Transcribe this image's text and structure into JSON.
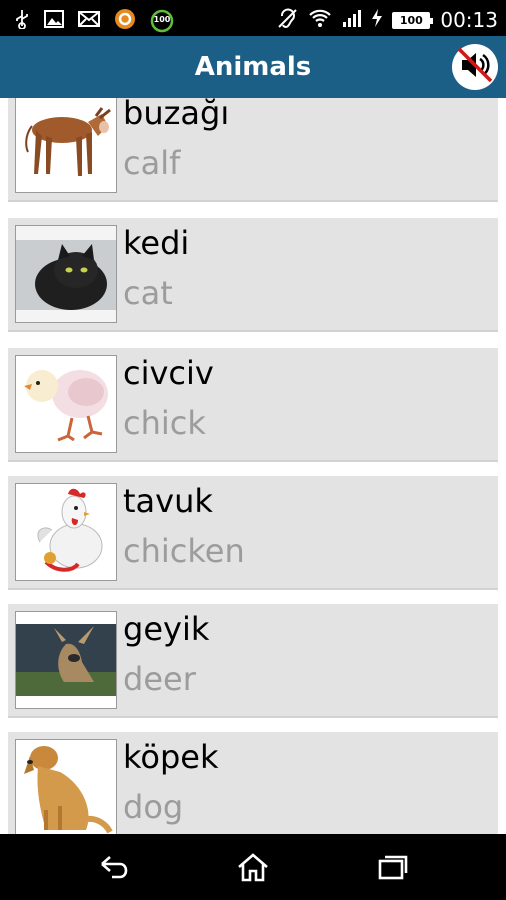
{
  "status_bar": {
    "battery_level": "100",
    "clock": "00:13",
    "notification_badge": "100"
  },
  "app_bar": {
    "title": "Animals",
    "mute_icon": "speaker-muted-icon"
  },
  "items": [
    {
      "word": "buzağı",
      "translation": "calf",
      "image": "calf-image"
    },
    {
      "word": "kedi",
      "translation": "cat",
      "image": "cat-image"
    },
    {
      "word": "civciv",
      "translation": "chick",
      "image": "chick-image"
    },
    {
      "word": "tavuk",
      "translation": "chicken",
      "image": "chicken-image"
    },
    {
      "word": "geyik",
      "translation": "deer",
      "image": "deer-image"
    },
    {
      "word": "köpek",
      "translation": "dog",
      "image": "dog-image"
    }
  ],
  "nav_bar": {
    "back": "back-icon",
    "home": "home-icon",
    "recents": "recents-icon"
  }
}
